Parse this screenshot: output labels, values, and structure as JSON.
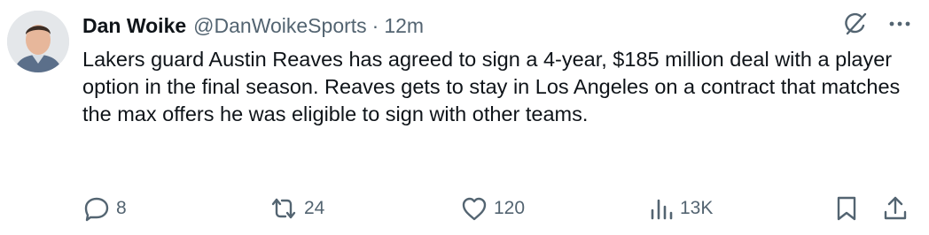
{
  "author": {
    "name": "Dan Woike",
    "handle": "@DanWoikeSports",
    "separator": "·",
    "time": "12m"
  },
  "tweet": {
    "text": "Lakers guard Austin Reaves has agreed to sign a 4-year, $185 million deal with a player option in the final season. Reaves gets to stay in Los Angeles on a contract that matches the max offers he was eligible to sign with other teams."
  },
  "metrics": {
    "replies": "8",
    "reposts": "24",
    "likes": "120",
    "views": "13K"
  },
  "icons": {
    "top": [
      "grok-icon",
      "more-icon"
    ],
    "actions": [
      "reply-icon",
      "repost-icon",
      "like-icon",
      "views-icon",
      "bookmark-icon",
      "share-icon"
    ]
  },
  "colors": {
    "text": "#0f1419",
    "muted": "#536471",
    "background": "#ffffff"
  }
}
